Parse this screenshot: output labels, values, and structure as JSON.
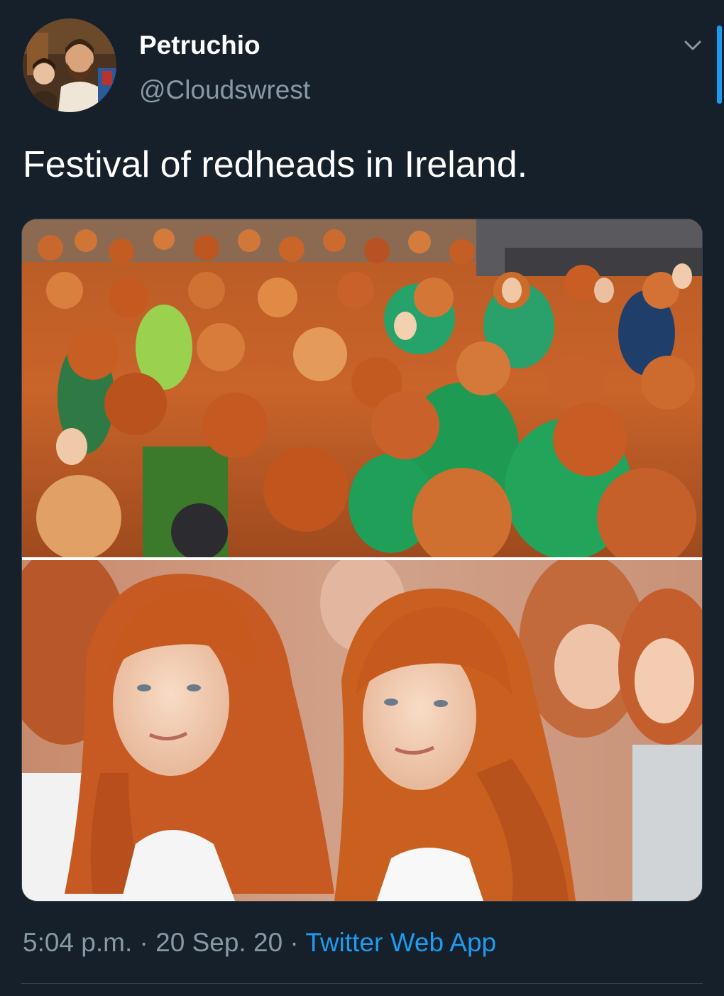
{
  "author": {
    "name": "Petruchio",
    "handle": "@Cloudswrest"
  },
  "tweet": {
    "text": "Festival of redheads in Ireland."
  },
  "meta": {
    "time": "5:04 p.m.",
    "separator": "·",
    "date": "20 Sep. 20",
    "source": "Twitter Web App"
  },
  "icons": {
    "caret": "chevron-down-icon"
  },
  "colors": {
    "background": "#15202b",
    "primary_text": "#ffffff",
    "secondary_text": "#8899a6",
    "link": "#1d9bf0"
  }
}
